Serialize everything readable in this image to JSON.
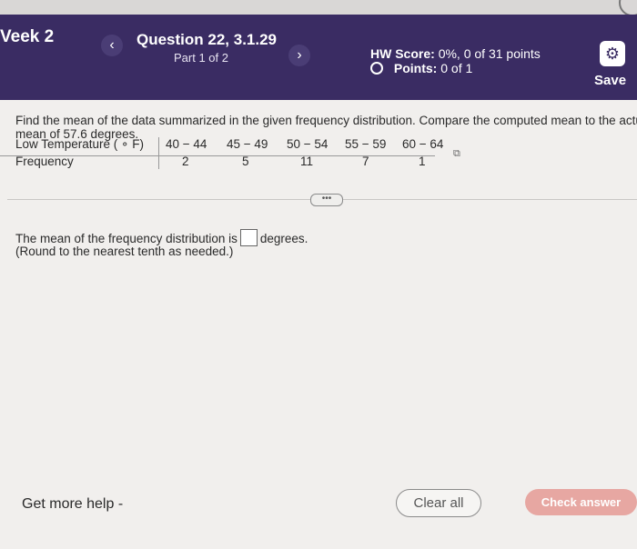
{
  "header": {
    "week": "Veek 2",
    "prev": "‹",
    "next": "›",
    "question_title": "Question 22, 3.1.29",
    "part": "Part 1 of 2",
    "hw_score_label": "HW Score:",
    "hw_score_value": "0%, 0 of 31 points",
    "points_label": "Points:",
    "points_value": "0 of 1",
    "save": "Save",
    "settings_icon": "gear-icon"
  },
  "question": {
    "text": "Find the mean of the data summarized in the given frequency distribution. Compare the computed mean to the actu mean of 57.6 degrees."
  },
  "table": {
    "row_labels": [
      "Low Temperature ( ∘ F)",
      "Frequency"
    ],
    "columns": [
      "40 − 44",
      "45 − 49",
      "50 − 54",
      "55 − 59",
      "60 − 64"
    ],
    "frequencies": [
      "2",
      "5",
      "11",
      "7",
      "1"
    ]
  },
  "answer": {
    "prefix": "The mean of the frequency distribution is",
    "suffix": "degrees.",
    "note": "(Round to the nearest tenth as needed.)",
    "value": ""
  },
  "footer": {
    "help": "Get more help -",
    "clear": "Clear all",
    "check": "Check answer"
  }
}
